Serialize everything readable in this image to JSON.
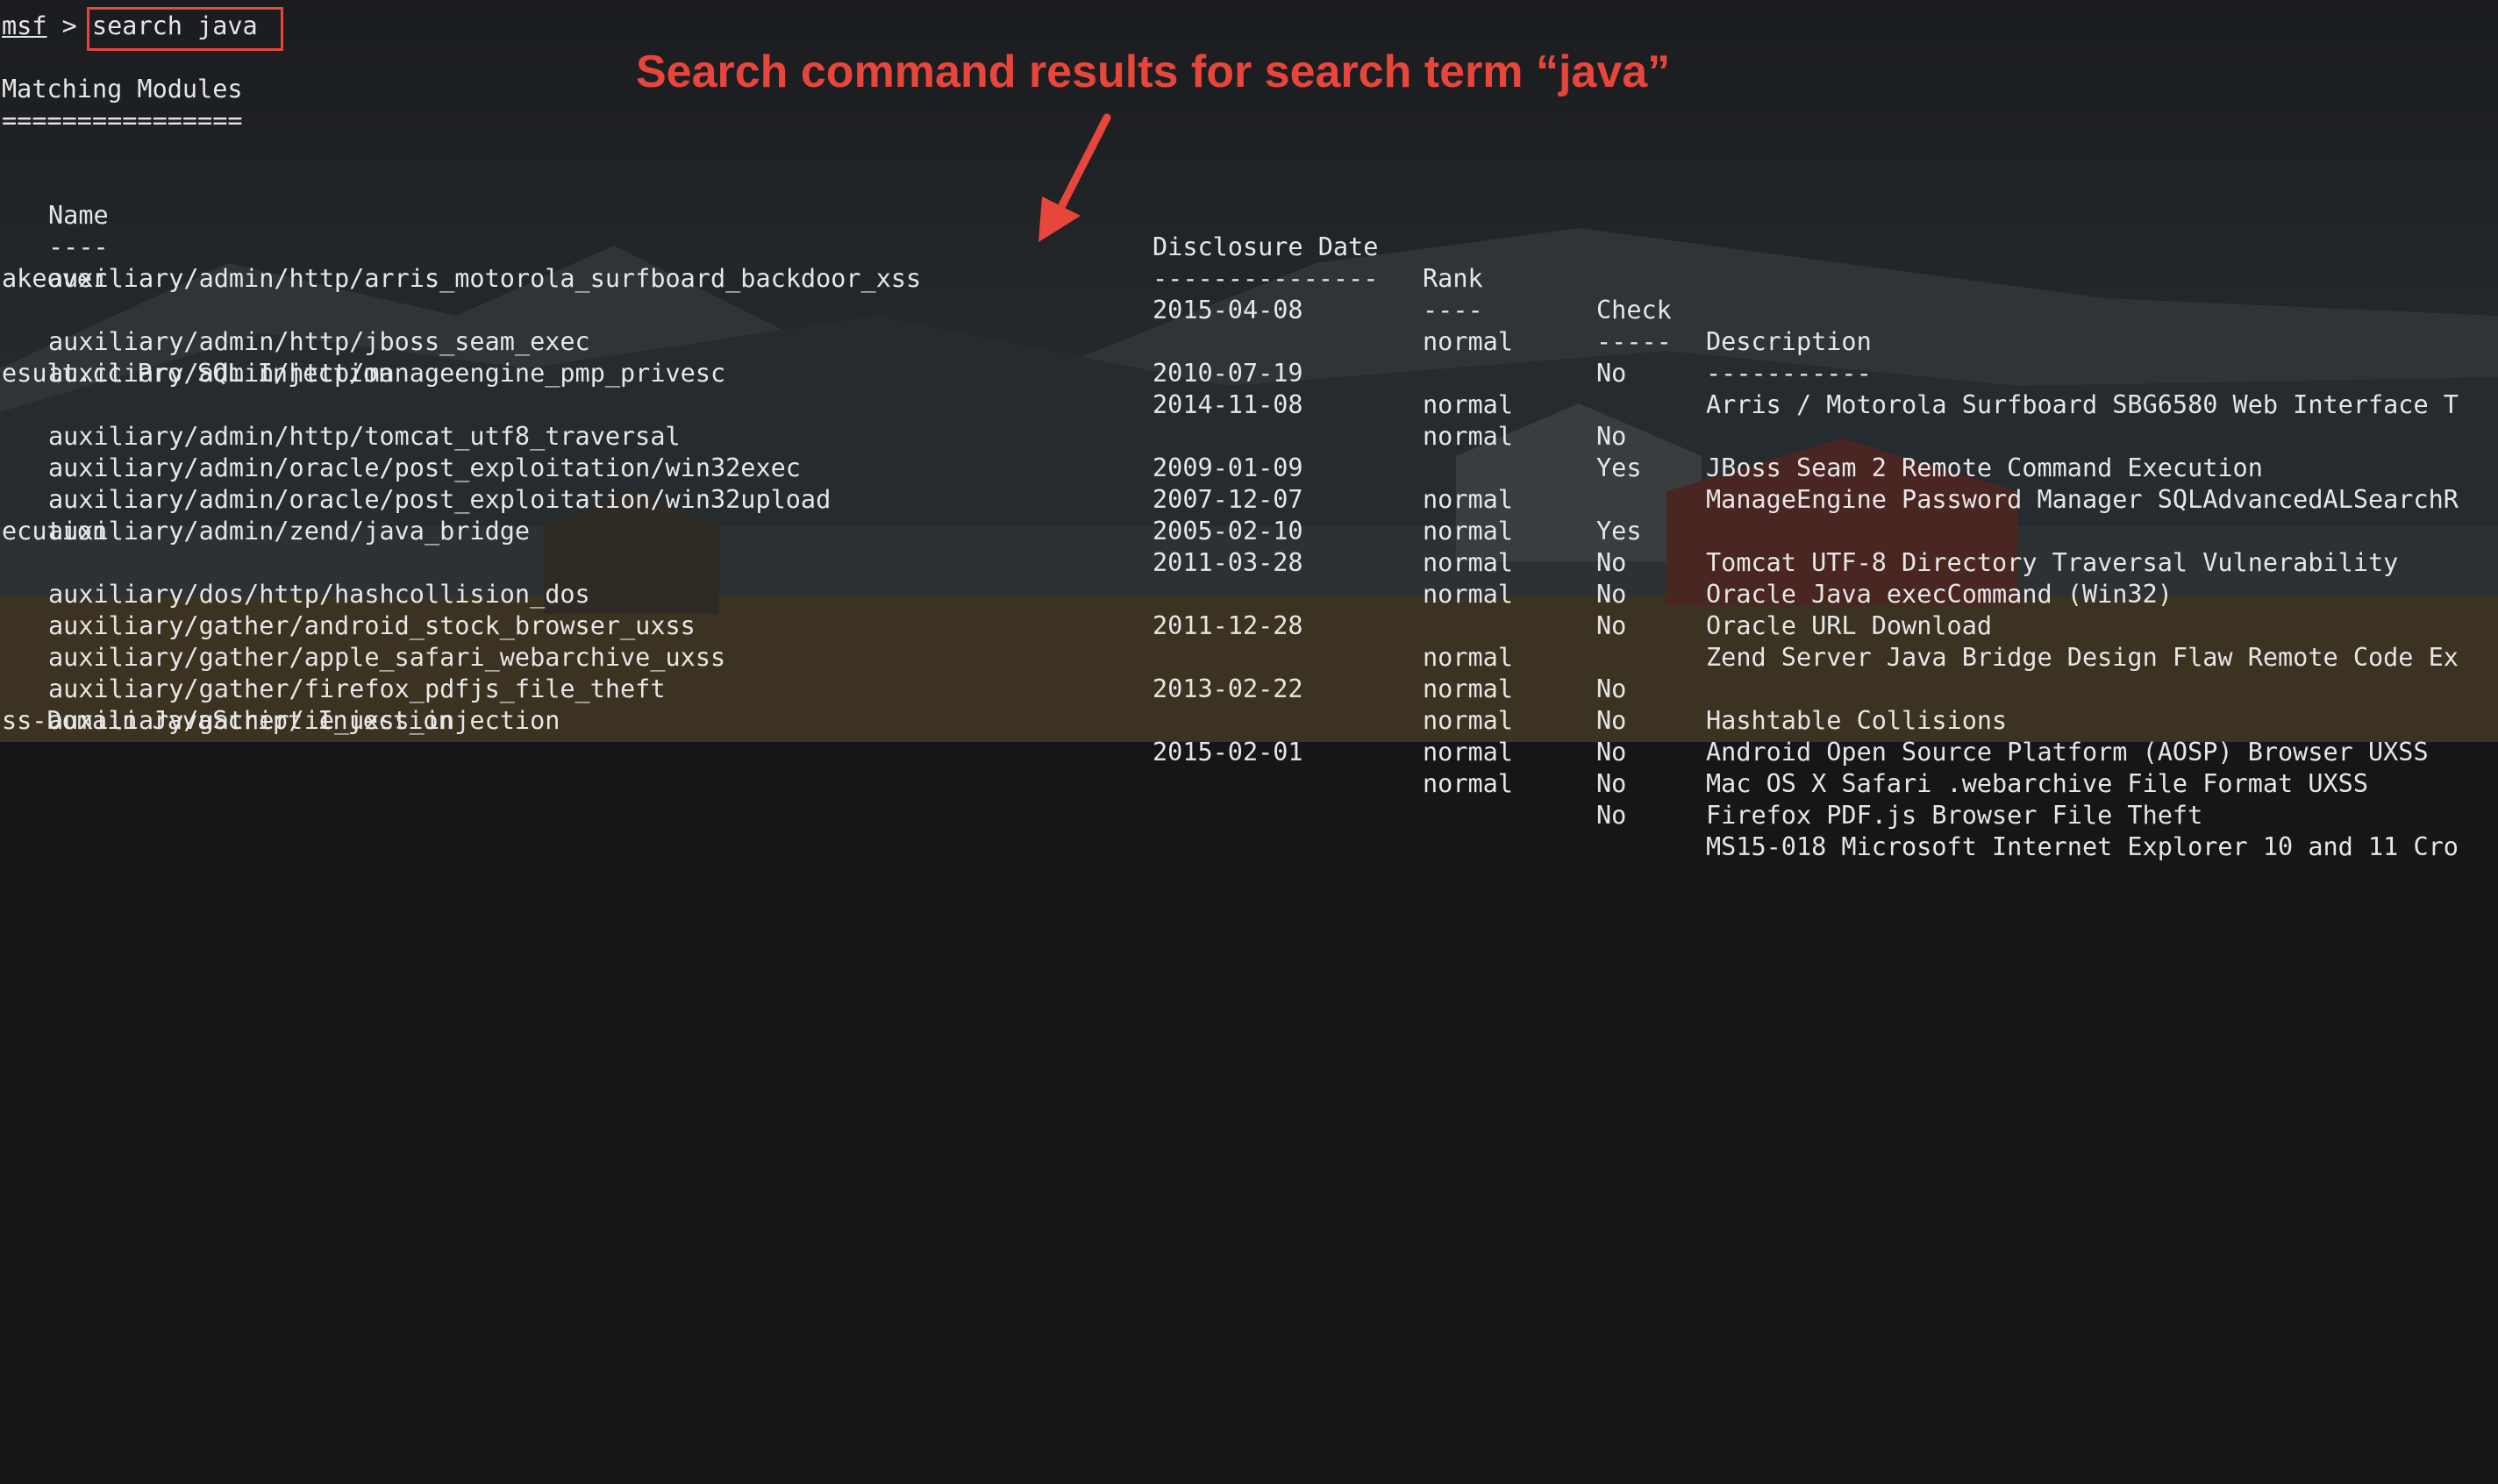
{
  "prompt": {
    "msf": "msf",
    "separator": " > ",
    "command": "search java"
  },
  "heading": "Matching Modules",
  "heading_rule": "================",
  "annotation": "Search command results for search term “java”",
  "table": {
    "headers": [
      "Name",
      "Disclosure Date",
      "Rank",
      "Check",
      "Description"
    ],
    "underlines": [
      "----",
      "---------------",
      "----",
      "-----",
      "-----------"
    ],
    "rows": [
      {
        "name": "auxiliary/admin/http/arris_motorola_surfboard_backdoor_xss",
        "date": "2015-04-08",
        "rank": "normal",
        "check": "No",
        "desc": "Arris / Motorola Surfboard SBG6580 Web Interface T",
        "wrap": "akeover"
      },
      {
        "name": "auxiliary/admin/http/jboss_seam_exec",
        "date": "2010-07-19",
        "rank": "normal",
        "check": "No",
        "desc": "JBoss Seam 2 Remote Command Execution",
        "wrap": ""
      },
      {
        "name": "auxiliary/admin/http/manageengine_pmp_privesc",
        "date": "2014-11-08",
        "rank": "normal",
        "check": "Yes",
        "desc": "ManageEngine Password Manager SQLAdvancedALSearchR",
        "wrap": "esult.cc Pro SQL Injection"
      },
      {
        "name": "auxiliary/admin/http/tomcat_utf8_traversal",
        "date": "2009-01-09",
        "rank": "normal",
        "check": "Yes",
        "desc": "Tomcat UTF-8 Directory Traversal Vulnerability",
        "wrap": ""
      },
      {
        "name": "auxiliary/admin/oracle/post_exploitation/win32exec",
        "date": "2007-12-07",
        "rank": "normal",
        "check": "No",
        "desc": "Oracle Java execCommand (Win32)",
        "wrap": ""
      },
      {
        "name": "auxiliary/admin/oracle/post_exploitation/win32upload",
        "date": "2005-02-10",
        "rank": "normal",
        "check": "No",
        "desc": "Oracle URL Download",
        "wrap": ""
      },
      {
        "name": "auxiliary/admin/zend/java_bridge",
        "date": "2011-03-28",
        "rank": "normal",
        "check": "No",
        "desc": "Zend Server Java Bridge Design Flaw Remote Code Ex",
        "wrap": "ecution"
      },
      {
        "name": "auxiliary/dos/http/hashcollision_dos",
        "date": "2011-12-28",
        "rank": "normal",
        "check": "No",
        "desc": "Hashtable Collisions",
        "wrap": ""
      },
      {
        "name": "auxiliary/gather/android_stock_browser_uxss",
        "date": "",
        "rank": "normal",
        "check": "No",
        "desc": "Android Open Source Platform (AOSP) Browser UXSS",
        "wrap": ""
      },
      {
        "name": "auxiliary/gather/apple_safari_webarchive_uxss",
        "date": "2013-02-22",
        "rank": "normal",
        "check": "No",
        "desc": "Mac OS X Safari .webarchive File Format UXSS",
        "wrap": ""
      },
      {
        "name": "auxiliary/gather/firefox_pdfjs_file_theft",
        "date": "",
        "rank": "normal",
        "check": "No",
        "desc": "Firefox PDF.js Browser File Theft",
        "wrap": ""
      },
      {
        "name": "auxiliary/gather/ie_uxss_injection",
        "date": "2015-02-01",
        "rank": "normal",
        "check": "No",
        "desc": "MS15-018 Microsoft Internet Explorer 10 and 11 Cro",
        "wrap": "ss-Domain JavaScript Injection"
      }
    ]
  },
  "colors": {
    "terminal_text": "#e6e6e6",
    "highlight": "#e8453b",
    "background": "#141618"
  }
}
